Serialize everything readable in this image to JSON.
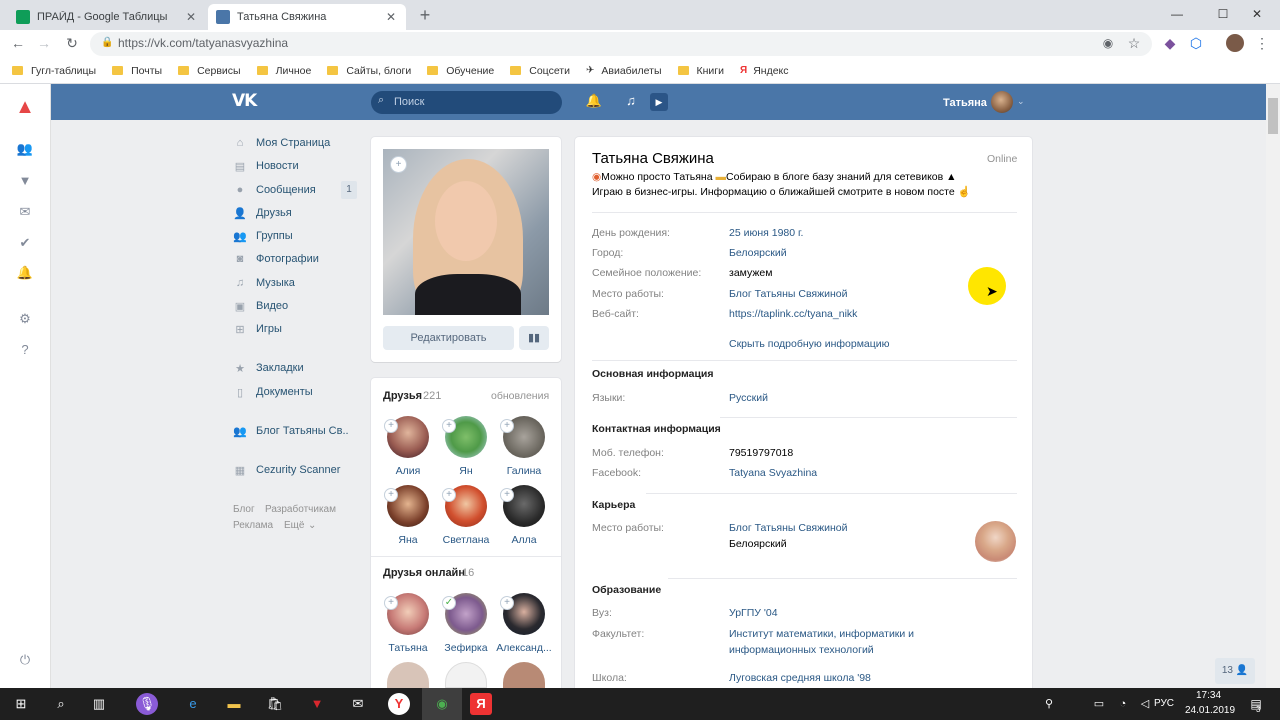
{
  "browser": {
    "tabs": [
      {
        "title": "ПРАЙД - Google Таблицы",
        "close": "✕"
      },
      {
        "title": "Татьяна Свяжина",
        "close": "✕"
      }
    ],
    "new_tab": "+",
    "window_controls": [
      "—",
      "☐",
      "✕"
    ],
    "url": "https://vk.com/tatyanasvyazhina",
    "bookmarks": [
      "Гугл-таблицы",
      "Почты",
      "Сервисы",
      "Личное",
      "Сайты, блоги",
      "Обучение",
      "Соцсети",
      "Авиабилеты",
      "Книги",
      "Яндекс"
    ]
  },
  "vk": {
    "search_placeholder": "Поиск",
    "user_name": "Татьяна",
    "menu": [
      {
        "label": "Моя Страница",
        "icon": "home-icon"
      },
      {
        "label": "Новости",
        "icon": "news-icon"
      },
      {
        "label": "Сообщения",
        "icon": "chat-icon"
      },
      {
        "label": "Друзья",
        "icon": "user-icon"
      },
      {
        "label": "Группы",
        "icon": "users-icon"
      },
      {
        "label": "Фотографии",
        "icon": "camera-icon"
      },
      {
        "label": "Музыка",
        "icon": "music-icon"
      },
      {
        "label": "Видео",
        "icon": "video-icon"
      },
      {
        "label": "Игры",
        "icon": "gamepad-icon"
      },
      {
        "label": "Закладки",
        "icon": "star-icon"
      },
      {
        "label": "Документы",
        "icon": "document-icon"
      },
      {
        "label": "Блог Татьяны Св..",
        "icon": "users-icon"
      },
      {
        "label": "Cezurity Scanner",
        "icon": "app-icon"
      }
    ],
    "messages_count": "1",
    "footer_links": [
      "Блог",
      "Разработчикам",
      "Реклама",
      "Ещё"
    ],
    "edit_button": "Редактировать",
    "friends": {
      "title": "Друзья",
      "count": "221",
      "updates": "обновления",
      "items": [
        "Алия",
        "Ян",
        "Галина",
        "Яна",
        "Светлана",
        "Алла"
      ]
    },
    "online": {
      "title": "Друзья онлайн",
      "count": "16",
      "items": [
        "Татьяна",
        "Зефирка",
        "Александ..."
      ]
    },
    "profile": {
      "name": "Татьяна Свяжина",
      "online": "Online",
      "status_line1": "Можно просто Татьяна",
      "status_line1b": "Собираю в блоге базу знаний для сетевиков",
      "status_line2": "Играю в бизнес-игры. Информацию о ближайшей смотрите в новом посте",
      "rows": [
        {
          "label": "День рождения:",
          "value": "25 июня 1980 г."
        },
        {
          "label": "Город:",
          "value": "Белоярский"
        },
        {
          "label": "Семейное положение:",
          "value": "замужем"
        },
        {
          "label": "Место работы:",
          "value": "Блог Татьяны Свяжиной"
        },
        {
          "label": "Веб-сайт:",
          "value": "https://taplink.cc/tyana_nikk"
        }
      ],
      "hide_info": "Скрыть подробную информацию",
      "basic_title": "Основная информация",
      "languages_label": "Языки:",
      "languages": "Русский",
      "contact_title": "Контактная информация",
      "phone_label": "Моб. телефон:",
      "phone": "79519797018",
      "facebook_label": "Facebook:",
      "facebook": "Tatyana Svyazhina",
      "career_title": "Карьера",
      "career_label": "Место работы:",
      "career_place": "Блог Татьяны Свяжиной",
      "career_city": "Белоярский",
      "edu_title": "Образование",
      "uni_label": "Вуз:",
      "uni": "УрГПУ '04",
      "faculty_label": "Факультет:",
      "faculty_1": "Институт математики, информатики и",
      "faculty_2": "информационных технологий",
      "school_label": "Школа:",
      "school": "Луговская средняя школа '98"
    },
    "chat_badge": "13"
  },
  "taskbar": {
    "time": "17:34",
    "date": "24.01.2019",
    "lang": "РУС",
    "notif": "3"
  }
}
